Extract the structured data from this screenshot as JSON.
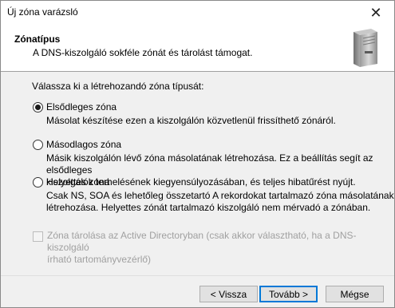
{
  "window": {
    "title": "Új zóna varázsló",
    "close_glyph": "✕"
  },
  "header": {
    "title": "Zónatípus",
    "subtitle": "A DNS-kiszolgáló sokféle zónát és tárolást támogat.",
    "icon": "server-icon"
  },
  "content": {
    "prompt": "Válassza ki a létrehozandó zóna típusát:",
    "options": [
      {
        "label": "Elsődleges zóna",
        "checked": true,
        "desc": [
          "Másolat készítése ezen a kiszolgálón közvetlenül frissíthető zónáról."
        ]
      },
      {
        "label": "Másodlagos zóna",
        "checked": false,
        "desc": [
          "Másik kiszolgálón lévő zóna másolatának létrehozása. Ez a beállítás segít az elsődleges",
          "kiszolgálók terhelésének kiegyensúlyozásában, és teljes hibatűrést nyújt."
        ]
      },
      {
        "label": "Helyettes zóna",
        "checked": false,
        "desc": [
          "Csak NS, SOA és lehetőleg összetartó A rekordokat tartalmazó zóna másolatának",
          "létrehozása. Helyettes zónát tartalmazó kiszolgáló nem mérvadó a zónában."
        ]
      }
    ],
    "ad_checkbox": {
      "label_lines": [
        "Zóna tárolása az Active Directoryban (csak akkor választható, ha a DNS-kiszolgáló",
        "írható tartományvezérlő)"
      ],
      "checked": false,
      "disabled": true
    }
  },
  "footer": {
    "back": "< Vissza",
    "next": "Tovább >",
    "cancel": "Mégse"
  }
}
